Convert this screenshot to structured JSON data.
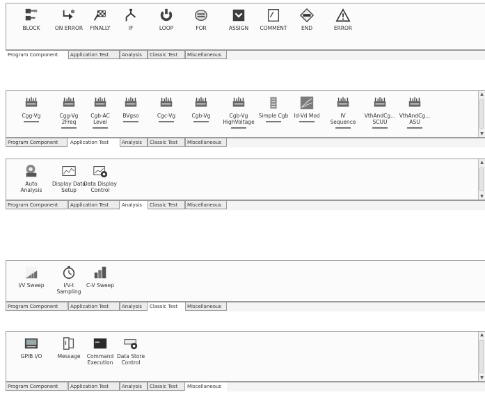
{
  "tabs": [
    "Program Component",
    "Application Test",
    "Analysis",
    "Classic Test",
    "Miscellaneous"
  ],
  "panels": [
    {
      "active_tab": 0,
      "items": [
        {
          "label": "BLOCK",
          "icon": "block-icon"
        },
        {
          "label": "ON ERROR",
          "icon": "on-error-icon"
        },
        {
          "label": "FINALLY",
          "icon": "finally-flag-icon"
        },
        {
          "label": "IF",
          "icon": "if-branch-icon"
        },
        {
          "label": "LOOP",
          "icon": "loop-icon"
        },
        {
          "label": "FOR",
          "icon": "for-icon"
        },
        {
          "label": "ASSIGN",
          "icon": "assign-icon"
        },
        {
          "label": "COMMENT",
          "icon": "comment-icon"
        },
        {
          "label": "END",
          "icon": "end-icon"
        },
        {
          "label": "ERROR",
          "icon": "error-warning-icon"
        }
      ]
    },
    {
      "active_tab": 1,
      "items": [
        {
          "label": "Cgg-Vg",
          "icon": "device-test-icon"
        },
        {
          "label": "Cgg-Vg\n2Freq",
          "icon": "device-test-icon"
        },
        {
          "label": "Cgb-AC\nLevel",
          "icon": "device-test-icon"
        },
        {
          "label": "BVgso",
          "icon": "device-test-icon"
        },
        {
          "label": "Cgc-Vg",
          "icon": "device-test-icon"
        },
        {
          "label": "Cgb-Vg",
          "icon": "device-test-icon"
        },
        {
          "label": "Cgb-Vg\nHighVoltage",
          "icon": "device-test-icon"
        },
        {
          "label": "Simple Cgb",
          "icon": "simple-cgb-icon"
        },
        {
          "label": "Id-Vd Mod",
          "icon": "id-vd-graph-icon"
        },
        {
          "label": "IV\nSequence",
          "icon": "device-test-icon"
        },
        {
          "label": "VthAndCg...\nSCUU",
          "icon": "device-test-icon"
        },
        {
          "label": "VthAndCg...\nASU",
          "icon": "device-test-icon"
        }
      ]
    },
    {
      "active_tab": 2,
      "items": [
        {
          "label": "Auto\nAnalysis",
          "icon": "auto-analysis-icon"
        },
        {
          "label": "Display Data\nSetup",
          "icon": "display-data-setup-icon"
        },
        {
          "label": "Data Display\nControl",
          "icon": "data-display-control-icon"
        }
      ]
    },
    {
      "active_tab": 3,
      "items": [
        {
          "label": "I/V Sweep",
          "icon": "iv-sweep-icon"
        },
        {
          "label": "I/V-t\nSampling",
          "icon": "stopwatch-icon"
        },
        {
          "label": "C-V Sweep",
          "icon": "cv-sweep-icon"
        }
      ]
    },
    {
      "active_tab": 4,
      "items": [
        {
          "label": "GPIB I/O",
          "icon": "gpib-io-icon"
        },
        {
          "label": "Message",
          "icon": "message-icon"
        },
        {
          "label": "Command\nExecution",
          "icon": "command-execution-icon"
        },
        {
          "label": "Data Store\nControl",
          "icon": "data-store-control-icon"
        }
      ]
    }
  ]
}
